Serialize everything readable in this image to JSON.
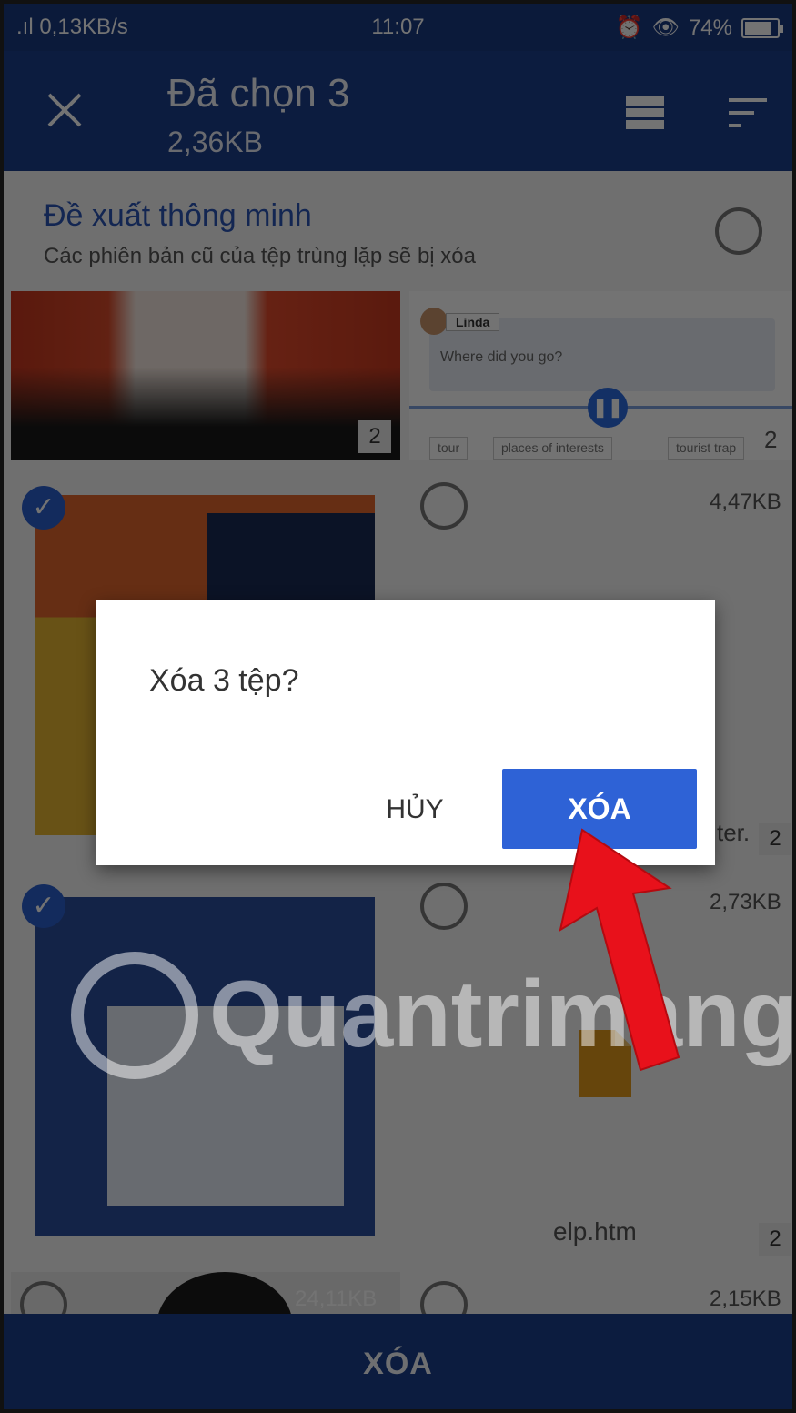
{
  "status_bar": {
    "network": ".ıl 0,13KB/s",
    "time": "11:07",
    "battery": "74%"
  },
  "app_bar": {
    "title": "Đã chọn 3",
    "subtitle": "2,36KB"
  },
  "smart_suggestion": {
    "title": "Đề xuất thông minh",
    "subtitle": "Các phiên bản cũ của tệp trùng lặp sẽ bị xóa"
  },
  "items": [
    {
      "count": "2"
    },
    {
      "chat_name": "Linda",
      "chat_message": "Where did you go?",
      "tags": [
        "tour",
        "places of interests",
        "tourist trap"
      ],
      "count": "2"
    },
    {
      "size": "4,47KB",
      "count": "2",
      "name_fragment": "ter."
    },
    {
      "size": "2,73KB",
      "count": "2",
      "name_fragment": "elp.htm"
    },
    {
      "size_left": "24,11KB",
      "size_right": "2,15KB"
    }
  ],
  "watermark": "Quantrimang",
  "dialog": {
    "title": "Xóa 3 tệp?",
    "cancel_label": "HỦY",
    "confirm_label": "XÓA"
  },
  "bottom_bar": {
    "action_label": "XÓA"
  },
  "colors": {
    "app_bar": "#1c3f8c",
    "accent": "#2e62d6",
    "annotation_arrow": "#e8111b"
  }
}
